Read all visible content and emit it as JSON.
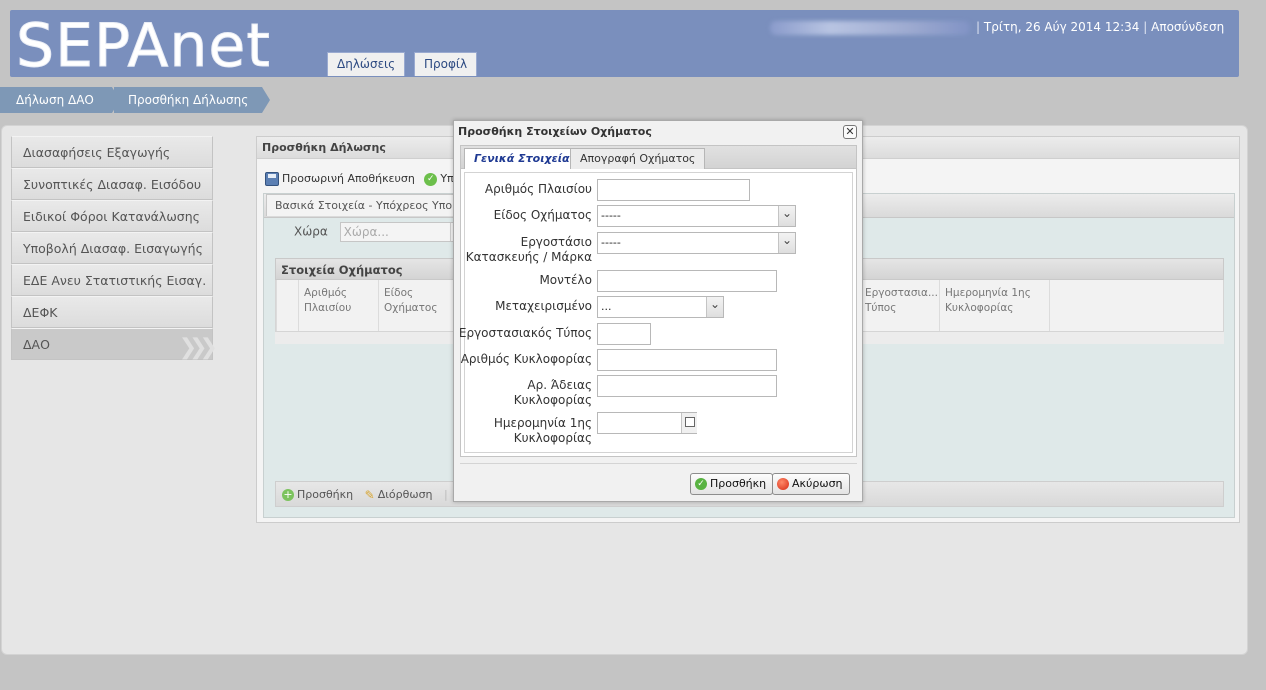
{
  "header": {
    "logo": "SEPAnet",
    "tabs": [
      "Δηλώσεις",
      "Προφίλ"
    ],
    "datetime": "Τρίτη, 26 Αύγ 2014 12:34",
    "logout": "Αποσύνδεση"
  },
  "breadcrumb": [
    "Δήλωση ΔΑΟ",
    "Προσθήκη Δήλωσης"
  ],
  "sidebar": {
    "items": [
      "Διασαφήσεις Εξαγωγής",
      "Συνοπτικές Διασαφ. Εισόδου",
      "Ειδικοί Φόροι Κατανάλωσης",
      "Υποβολή Διασαφ. Εισαγωγής",
      "ΕΔΕ Ανευ Στατιστικής Εισαγ.",
      "ΔΕΦΚ",
      "ΔΑΟ"
    ]
  },
  "content": {
    "title": "Προσθήκη Δήλωσης",
    "toolbar": {
      "temp_save": "Προσωρινή Αποθήκευση",
      "submit": "Υπο"
    },
    "subtab": "Βασικά Στοιχεία - Υπόχρεος Υποβολής",
    "country_label": "Χώρα",
    "country_placeholder": "Χώρα...",
    "vehicle_grid": {
      "title": "Στοιχεία Οχήματος",
      "columns": [
        {
          "line1": "Αριθμός",
          "line2": "Πλαισίου"
        },
        {
          "line1": "Είδος",
          "line2": "Οχήματος"
        },
        {
          "line1": "Εργοστασια...",
          "line2": "Τύπος"
        },
        {
          "line1": "Ημερομηνία 1ης",
          "line2": "Κυκλοφορίας"
        }
      ]
    },
    "bottom_bar": {
      "add": "Προσθήκη",
      "edit": "Διόρθωση"
    }
  },
  "modal": {
    "title": "Προσθήκη Στοιχείων Οχήματος",
    "tabs": [
      "Γενικά Στοιχεία",
      "Απογραφή Οχήματος"
    ],
    "fields": {
      "chassis": "Αριθμός Πλαισίου",
      "vehicle_type": "Είδος Οχήματος",
      "vehicle_type_value": "-----",
      "manufacturer_1": "Εργοστάσιο",
      "manufacturer_2": "Κατασκευής / Μάρκα",
      "manufacturer_value": "-----",
      "model": "Μοντέλο",
      "used": "Μεταχειρισμένο",
      "used_value": "...",
      "factory_type": "Εργοστασιακός Τύπος",
      "reg_number": "Αριθμός Κυκλοφορίας",
      "license_1": "Αρ. Άδειας",
      "license_2": "Κυκλοφορίας",
      "first_reg_1": "Ημερομηνία 1ης",
      "first_reg_2": "Κυκλοφορίας"
    },
    "buttons": {
      "add": "Προσθήκη",
      "cancel": "Ακύρωση"
    }
  }
}
